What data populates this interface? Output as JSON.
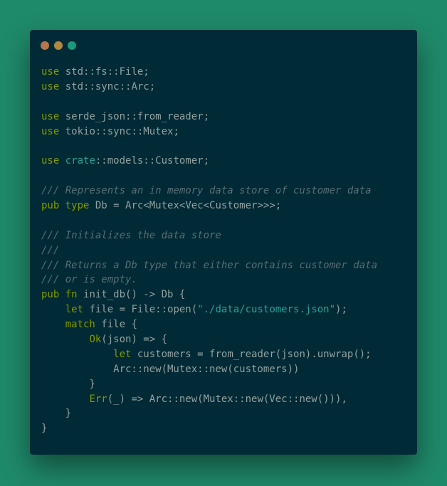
{
  "window": {
    "controls": [
      {
        "name": "close",
        "color": "#b5774a"
      },
      {
        "name": "minimize",
        "color": "#b08a43"
      },
      {
        "name": "maximize",
        "color": "#1a9a7a"
      }
    ]
  },
  "code": {
    "language": "rust",
    "lines": [
      [
        {
          "t": "use",
          "c": "kw"
        },
        {
          "t": " std::fs::File;",
          "c": "tx"
        }
      ],
      [
        {
          "t": "use",
          "c": "kw"
        },
        {
          "t": " std::sync::Arc;",
          "c": "tx"
        }
      ],
      [],
      [
        {
          "t": "use",
          "c": "kw"
        },
        {
          "t": " serde_json::from_reader;",
          "c": "tx"
        }
      ],
      [
        {
          "t": "use",
          "c": "kw"
        },
        {
          "t": " tokio::sync::Mutex;",
          "c": "tx"
        }
      ],
      [],
      [
        {
          "t": "use",
          "c": "kw"
        },
        {
          "t": " crate",
          "c": "ns"
        },
        {
          "t": "::models::Customer;",
          "c": "tx"
        }
      ],
      [],
      [
        {
          "t": "/// Represents an in memory data store of customer data",
          "c": "cm"
        }
      ],
      [
        {
          "t": "pub",
          "c": "kw"
        },
        {
          "t": " type",
          "c": "kw"
        },
        {
          "t": " Db = Arc<Mutex<Vec<Customer>>>;",
          "c": "tx"
        }
      ],
      [],
      [
        {
          "t": "/// Initializes the data store",
          "c": "cm"
        }
      ],
      [
        {
          "t": "///",
          "c": "cm"
        }
      ],
      [
        {
          "t": "/// Returns a Db type that either contains customer data",
          "c": "cm"
        }
      ],
      [
        {
          "t": "/// or is empty.",
          "c": "cm"
        }
      ],
      [
        {
          "t": "pub",
          "c": "kw"
        },
        {
          "t": " fn",
          "c": "kw"
        },
        {
          "t": " init_db() -> Db {",
          "c": "tx"
        }
      ],
      [
        {
          "t": "    "
        },
        {
          "t": "let",
          "c": "kw"
        },
        {
          "t": " file = File::open(",
          "c": "tx"
        },
        {
          "t": "\"./data/customers.json\"",
          "c": "st"
        },
        {
          "t": ");",
          "c": "tx"
        }
      ],
      [
        {
          "t": "    "
        },
        {
          "t": "match",
          "c": "kw"
        },
        {
          "t": " file {",
          "c": "tx"
        }
      ],
      [
        {
          "t": "        "
        },
        {
          "t": "Ok",
          "c": "kw"
        },
        {
          "t": "(json) => {",
          "c": "tx"
        }
      ],
      [
        {
          "t": "            "
        },
        {
          "t": "let",
          "c": "kw"
        },
        {
          "t": " customers = from_reader(json).unwrap();",
          "c": "tx"
        }
      ],
      [
        {
          "t": "            Arc::new(Mutex::new(customers))",
          "c": "tx"
        }
      ],
      [
        {
          "t": "        }",
          "c": "tx"
        }
      ],
      [
        {
          "t": "        "
        },
        {
          "t": "Err",
          "c": "kw"
        },
        {
          "t": "(_) => Arc::new(Mutex::new(Vec::new())),",
          "c": "tx"
        }
      ],
      [
        {
          "t": "    }",
          "c": "tx"
        }
      ],
      [
        {
          "t": "}",
          "c": "tx"
        }
      ]
    ]
  }
}
